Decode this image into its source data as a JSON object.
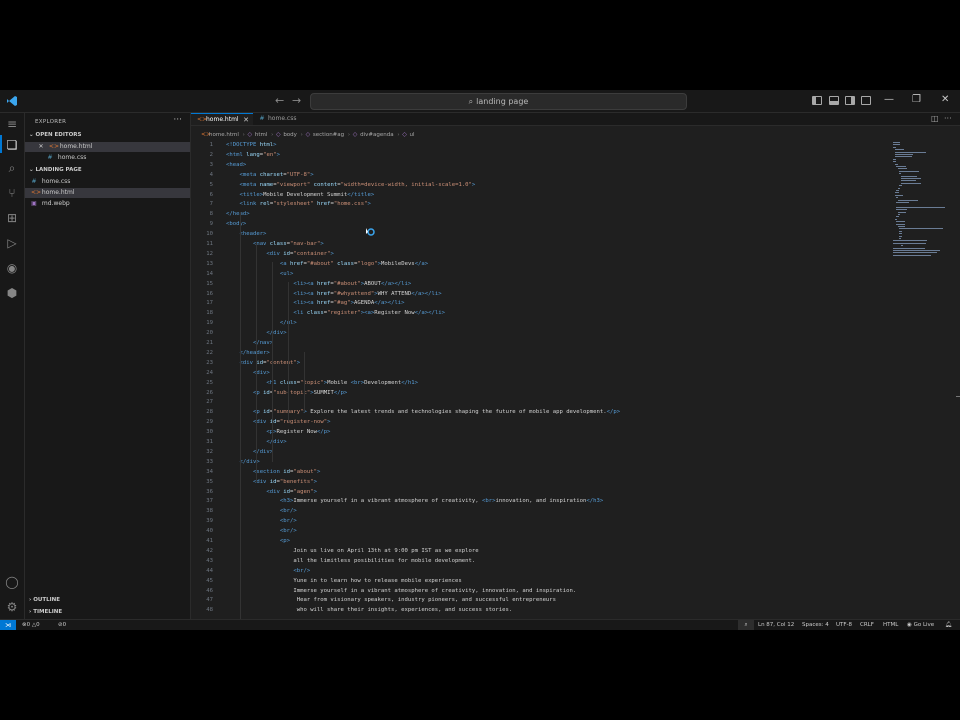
{
  "titlebar": {
    "search_text": "landing page"
  },
  "sidebar": {
    "title": "EXPLORER",
    "more": "···",
    "open_editors_label": "OPEN EDITORS",
    "open_editors": [
      {
        "name": "home.html",
        "type": "html",
        "close": "✕"
      },
      {
        "name": "home.css",
        "type": "css"
      }
    ],
    "project_label": "LANDING PAGE",
    "files": [
      {
        "name": "home.css",
        "type": "css"
      },
      {
        "name": "home.html",
        "type": "html"
      },
      {
        "name": "md.webp",
        "type": "img"
      }
    ],
    "outline_label": "OUTLINE",
    "timeline_label": "TIMELINE"
  },
  "tabs": [
    {
      "label": "home.html",
      "type": "html",
      "active": true
    },
    {
      "label": "home.css",
      "type": "css",
      "active": false
    }
  ],
  "breadcrumb": [
    "home.html",
    "html",
    "body",
    "section#ag",
    "div#agenda",
    "ul"
  ],
  "code": [
    {
      "n": "1",
      "t": [
        [
          "tag",
          "<!DOCTYPE "
        ],
        [
          "att",
          "html"
        ],
        [
          "tag",
          ">"
        ]
      ]
    },
    {
      "n": "2",
      "t": [
        [
          "tag",
          "<html "
        ],
        [
          "att",
          "lang"
        ],
        [
          "txt",
          "="
        ],
        [
          "str",
          "\"en\""
        ],
        [
          "tag",
          ">"
        ]
      ]
    },
    {
      "n": "3",
      "t": [
        [
          "tag",
          "<head>"
        ]
      ]
    },
    {
      "n": "4",
      "t": [
        [
          "txt",
          "    "
        ],
        [
          "tag",
          "<meta "
        ],
        [
          "att",
          "charset"
        ],
        [
          "txt",
          "="
        ],
        [
          "str",
          "\"UTF-8\""
        ],
        [
          "tag",
          ">"
        ]
      ]
    },
    {
      "n": "5",
      "t": [
        [
          "txt",
          "    "
        ],
        [
          "tag",
          "<meta "
        ],
        [
          "att",
          "name"
        ],
        [
          "txt",
          "="
        ],
        [
          "str",
          "\"viewport\""
        ],
        [
          "att",
          " content"
        ],
        [
          "txt",
          "="
        ],
        [
          "str",
          "\"width=device-width, initial-scale=1.0\""
        ],
        [
          "tag",
          ">"
        ]
      ]
    },
    {
      "n": "6",
      "t": [
        [
          "txt",
          "    "
        ],
        [
          "tag",
          "<title>"
        ],
        [
          "txt",
          "Mobile Development Summit"
        ],
        [
          "tag",
          "</title>"
        ]
      ]
    },
    {
      "n": "7",
      "t": [
        [
          "txt",
          "    "
        ],
        [
          "tag",
          "<link "
        ],
        [
          "att",
          "rel"
        ],
        [
          "txt",
          "="
        ],
        [
          "str",
          "\"stylesheet\""
        ],
        [
          "att",
          " href"
        ],
        [
          "txt",
          "="
        ],
        [
          "str",
          "\"home.css\""
        ],
        [
          "tag",
          ">"
        ]
      ]
    },
    {
      "n": "8",
      "t": [
        [
          "tag",
          "</head>"
        ]
      ]
    },
    {
      "n": "9",
      "t": [
        [
          "tag",
          "<body>"
        ]
      ]
    },
    {
      "n": "10",
      "t": [
        [
          "txt",
          "    "
        ],
        [
          "tag",
          "<header>"
        ]
      ]
    },
    {
      "n": "11",
      "t": [
        [
          "txt",
          "        "
        ],
        [
          "tag",
          "<nav "
        ],
        [
          "att",
          "class"
        ],
        [
          "txt",
          "="
        ],
        [
          "str",
          "\"nav-bar\""
        ],
        [
          "tag",
          ">"
        ]
      ]
    },
    {
      "n": "12",
      "t": [
        [
          "txt",
          "            "
        ],
        [
          "tag",
          "<div "
        ],
        [
          "att",
          "id"
        ],
        [
          "txt",
          "="
        ],
        [
          "str",
          "\"container\""
        ],
        [
          "tag",
          ">"
        ]
      ]
    },
    {
      "n": "13",
      "t": [
        [
          "txt",
          "                "
        ],
        [
          "tag",
          "<a "
        ],
        [
          "att",
          "href"
        ],
        [
          "txt",
          "="
        ],
        [
          "str",
          "\"#about\""
        ],
        [
          "att",
          " class"
        ],
        [
          "txt",
          "="
        ],
        [
          "str",
          "\"logo\""
        ],
        [
          "tag",
          ">"
        ],
        [
          "txt",
          "MobileDevs"
        ],
        [
          "tag",
          "</a>"
        ]
      ]
    },
    {
      "n": "14",
      "t": [
        [
          "txt",
          "                "
        ],
        [
          "tag",
          "<ul>"
        ]
      ]
    },
    {
      "n": "15",
      "t": [
        [
          "txt",
          "                    "
        ],
        [
          "tag",
          "<li><a "
        ],
        [
          "att",
          "href"
        ],
        [
          "txt",
          "="
        ],
        [
          "str",
          "\"#about\""
        ],
        [
          "tag",
          ">"
        ],
        [
          "txt",
          "ABOUT"
        ],
        [
          "tag",
          "</a></li>"
        ]
      ]
    },
    {
      "n": "16",
      "t": [
        [
          "txt",
          "                    "
        ],
        [
          "tag",
          "<li><a "
        ],
        [
          "att",
          "href"
        ],
        [
          "txt",
          "="
        ],
        [
          "str",
          "\"#whyattend\""
        ],
        [
          "tag",
          ">"
        ],
        [
          "txt",
          "WHY ATTEND"
        ],
        [
          "tag",
          "</a></li>"
        ]
      ]
    },
    {
      "n": "17",
      "t": [
        [
          "txt",
          "                    "
        ],
        [
          "tag",
          "<li><a "
        ],
        [
          "att",
          "href"
        ],
        [
          "txt",
          "="
        ],
        [
          "str",
          "\"#ag\""
        ],
        [
          "tag",
          ">"
        ],
        [
          "txt",
          "AGENDA"
        ],
        [
          "tag",
          "</a></li>"
        ]
      ]
    },
    {
      "n": "18",
      "t": [
        [
          "txt",
          "                    "
        ],
        [
          "tag",
          "<li "
        ],
        [
          "att",
          "class"
        ],
        [
          "txt",
          "="
        ],
        [
          "str",
          "\"register\""
        ],
        [
          "tag",
          "><a>"
        ],
        [
          "txt",
          "Register Now"
        ],
        [
          "tag",
          "</a></li>"
        ]
      ]
    },
    {
      "n": "19",
      "t": [
        [
          "txt",
          "                "
        ],
        [
          "tag",
          "</ul>"
        ]
      ]
    },
    {
      "n": "20",
      "t": [
        [
          "txt",
          "            "
        ],
        [
          "tag",
          "</div>"
        ]
      ]
    },
    {
      "n": "21",
      "t": [
        [
          "txt",
          "        "
        ],
        [
          "tag",
          "</nav>"
        ]
      ]
    },
    {
      "n": "22",
      "t": [
        [
          "txt",
          "    "
        ],
        [
          "tag",
          "</header>"
        ]
      ]
    },
    {
      "n": "23",
      "t": [
        [
          "txt",
          "    "
        ],
        [
          "tag",
          "<div "
        ],
        [
          "att",
          "id"
        ],
        [
          "txt",
          "="
        ],
        [
          "str",
          "\"content\""
        ],
        [
          "tag",
          ">"
        ]
      ]
    },
    {
      "n": "24",
      "t": [
        [
          "txt",
          "        "
        ],
        [
          "tag",
          "<div>"
        ]
      ]
    },
    {
      "n": "25",
      "t": [
        [
          "txt",
          "            "
        ],
        [
          "tag",
          "<h1 "
        ],
        [
          "att",
          "class"
        ],
        [
          "txt",
          "="
        ],
        [
          "str",
          "\"topic\""
        ],
        [
          "tag",
          ">"
        ],
        [
          "txt",
          "Mobile "
        ],
        [
          "tag",
          "<br>"
        ],
        [
          "txt",
          "Development"
        ],
        [
          "tag",
          "</h1>"
        ]
      ]
    },
    {
      "n": "26",
      "t": [
        [
          "txt",
          "        "
        ],
        [
          "tag",
          "<p "
        ],
        [
          "att",
          "id"
        ],
        [
          "txt",
          "="
        ],
        [
          "str",
          "\"sub-topic\""
        ],
        [
          "tag",
          ">"
        ],
        [
          "txt",
          "SUMMIT"
        ],
        [
          "tag",
          "</p>"
        ]
      ]
    },
    {
      "n": "27",
      "t": []
    },
    {
      "n": "28",
      "t": [
        [
          "txt",
          "        "
        ],
        [
          "tag",
          "<p "
        ],
        [
          "att",
          "id"
        ],
        [
          "txt",
          "="
        ],
        [
          "str",
          "\"summary\""
        ],
        [
          "tag",
          ">"
        ],
        [
          "txt",
          " Explore the latest trends and technologies shaping the future of mobile app development."
        ],
        [
          "tag",
          "</p>"
        ]
      ]
    },
    {
      "n": "29",
      "t": [
        [
          "txt",
          "        "
        ],
        [
          "tag",
          "<div "
        ],
        [
          "att",
          "id"
        ],
        [
          "txt",
          "="
        ],
        [
          "str",
          "\"register-now\""
        ],
        [
          "tag",
          ">"
        ]
      ]
    },
    {
      "n": "30",
      "t": [
        [
          "txt",
          "            "
        ],
        [
          "tag",
          "<p>"
        ],
        [
          "txt",
          "Register Now"
        ],
        [
          "tag",
          "</p>"
        ]
      ]
    },
    {
      "n": "31",
      "t": [
        [
          "txt",
          "            "
        ],
        [
          "tag",
          "</div>"
        ]
      ]
    },
    {
      "n": "32",
      "t": [
        [
          "txt",
          "        "
        ],
        [
          "tag",
          "</div>"
        ]
      ]
    },
    {
      "n": "33",
      "t": [
        [
          "txt",
          "    "
        ],
        [
          "tag",
          "</div>"
        ]
      ]
    },
    {
      "n": "34",
      "t": [
        [
          "txt",
          "        "
        ],
        [
          "tag",
          "<section "
        ],
        [
          "att",
          "id"
        ],
        [
          "txt",
          "="
        ],
        [
          "str",
          "\"about\""
        ],
        [
          "tag",
          ">"
        ]
      ]
    },
    {
      "n": "35",
      "t": [
        [
          "txt",
          "        "
        ],
        [
          "tag",
          "<div "
        ],
        [
          "att",
          "id"
        ],
        [
          "txt",
          "="
        ],
        [
          "str",
          "\"benefits\""
        ],
        [
          "tag",
          ">"
        ]
      ]
    },
    {
      "n": "36",
      "t": [
        [
          "txt",
          "            "
        ],
        [
          "tag",
          "<div "
        ],
        [
          "att",
          "id"
        ],
        [
          "txt",
          "="
        ],
        [
          "str",
          "\"agen\""
        ],
        [
          "tag",
          ">"
        ]
      ]
    },
    {
      "n": "37",
      "t": [
        [
          "txt",
          "                "
        ],
        [
          "tag",
          "<h3>"
        ],
        [
          "txt",
          "Immerse yourself in a vibrant atmosphere of creativity, "
        ],
        [
          "tag",
          "<br>"
        ],
        [
          "txt",
          "innovation, and inspiration"
        ],
        [
          "tag",
          "</h3>"
        ]
      ]
    },
    {
      "n": "38",
      "t": [
        [
          "txt",
          "                "
        ],
        [
          "tag",
          "<br/>"
        ]
      ]
    },
    {
      "n": "39",
      "t": [
        [
          "txt",
          "                "
        ],
        [
          "tag",
          "<br/>"
        ]
      ]
    },
    {
      "n": "40",
      "t": [
        [
          "txt",
          "                "
        ],
        [
          "tag",
          "<br/>"
        ]
      ]
    },
    {
      "n": "41",
      "t": [
        [
          "txt",
          "                "
        ],
        [
          "tag",
          "<p>"
        ]
      ]
    },
    {
      "n": "42",
      "t": [
        [
          "txt",
          "                    Join us live on April 13th at 9:00 pm IST as we explore"
        ]
      ]
    },
    {
      "n": "43",
      "t": [
        [
          "txt",
          "                    all the limitless posibilities for mobile development."
        ]
      ]
    },
    {
      "n": "44",
      "t": [
        [
          "txt",
          "                    "
        ],
        [
          "tag",
          "<br/>"
        ]
      ]
    },
    {
      "n": "45",
      "t": [
        [
          "txt",
          "                    Yune in to learn how to release mobile experiences"
        ]
      ]
    },
    {
      "n": "46",
      "t": [
        [
          "txt",
          "                    Immerse yourself in a vibrant atmosphere of creativity, innovation, and inspiration."
        ]
      ]
    },
    {
      "n": "47",
      "t": [
        [
          "txt",
          "                     Hear from visionary speakers, industry pioneers, and successful entrepreneurs"
        ]
      ]
    },
    {
      "n": "48",
      "t": [
        [
          "txt",
          "                     who will share their insights, experiences, and success stories."
        ]
      ]
    }
  ],
  "status": {
    "errors": "0",
    "warnings": "0",
    "ports": "0",
    "position": "Ln 87, Col 12",
    "spaces": "Spaces: 4",
    "encoding": "UTF-8",
    "eol": "CRLF",
    "language": "HTML",
    "golive": "Go Live"
  }
}
